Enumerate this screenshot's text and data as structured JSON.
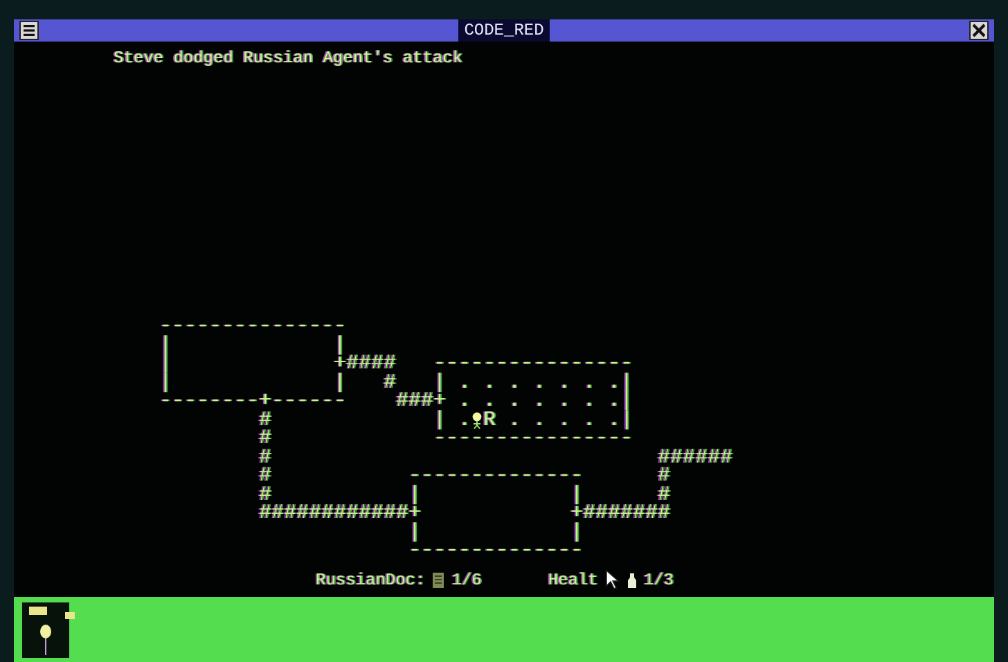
{
  "window": {
    "title": "CODE_RED"
  },
  "message": "Steve dodged Russian Agent's attack",
  "map": {
    "rows": [
      {
        "text": "---------------"
      },
      {
        "text": "|             |"
      },
      {
        "text": "|             +####   ----------------"
      },
      {
        "text": "|             |   #   | . . . . . . .|"
      },
      {
        "text": "--------+------    ###+ . . . . . . .|"
      },
      {
        "text": "        #             | .",
        "rest": "R . . . . .|"
      },
      {
        "text": "        #             ----------------"
      },
      {
        "text": "        #                               ######"
      },
      {
        "text": "        #           --------------      #"
      },
      {
        "text": "        #           |            |      #"
      },
      {
        "text": "        ############+            +#######"
      },
      {
        "text": "                    |            |"
      },
      {
        "text": "                    --------------"
      }
    ]
  },
  "status": {
    "docs_label": "RussianDoc:",
    "docs_count": "1/6",
    "health_label": "Healt",
    "health_count": "1/3"
  }
}
